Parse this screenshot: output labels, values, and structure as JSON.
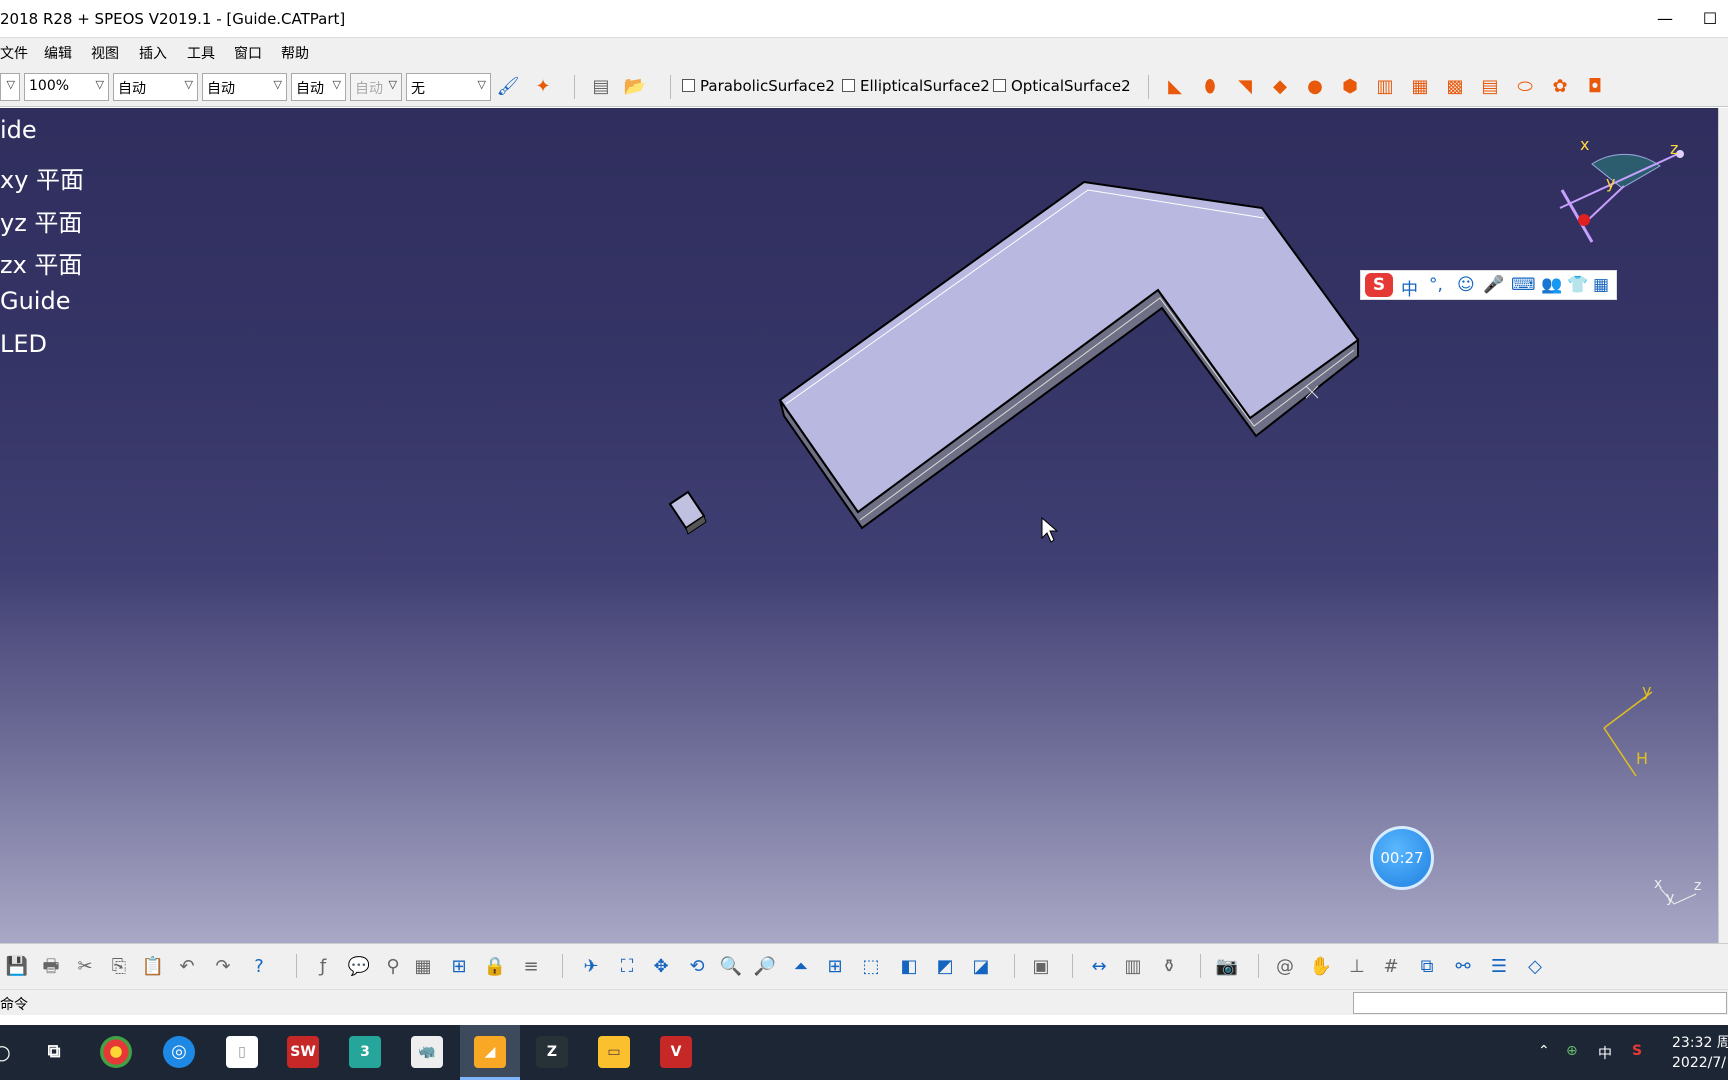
{
  "window": {
    "title": "2018 R28 + SPEOS V2019.1 - [Guide.CATPart]",
    "minimize_glyph": "—",
    "maximize_glyph": "☐"
  },
  "menu": [
    "文件",
    "编辑",
    "视图",
    "插入",
    "工具",
    "窗口",
    "帮助"
  ],
  "toolbar": {
    "zoom": "100%",
    "combo1": "自动",
    "combo2": "自动",
    "combo3": "自动",
    "combo4": "自动",
    "combo5": "无",
    "checkboxes": [
      "ParabolicSurface2",
      "EllipticalSurface2",
      "OpticalSurface2"
    ]
  },
  "tree": {
    "items": [
      "ide",
      "xy 平面",
      "yz 平面",
      "zx 平面",
      "Guide",
      "LED"
    ]
  },
  "compass": {
    "x": "x",
    "y": "y",
    "z": "z"
  },
  "axis_small": {
    "y": "y",
    "h": "H"
  },
  "axis_corner": {
    "x": "x",
    "y": "y",
    "z": "z"
  },
  "ime": {
    "logo": "S",
    "mode": "中",
    "punct": "°,",
    "face": "☺",
    "mic": "🎤",
    "kbd": "⌨",
    "person": "👥",
    "shirt": "👕",
    "grid": "▦"
  },
  "timer": "00:27",
  "statusbar": {
    "prompt": "命令"
  },
  "taskbar": {
    "sw_label": "SW",
    "three_label": "3",
    "v_label": "V",
    "ime_mode": "中",
    "clock_time": "23:32 周",
    "clock_date": "2022/7/"
  },
  "colors": {
    "viewport_top": "#2f2e5d",
    "viewport_bottom": "#a9a8c6",
    "part_face": "#b8b8e0",
    "part_side": "#7a7a8e",
    "taskbar": "#1c2634",
    "accent_orange": "#e8590c"
  }
}
